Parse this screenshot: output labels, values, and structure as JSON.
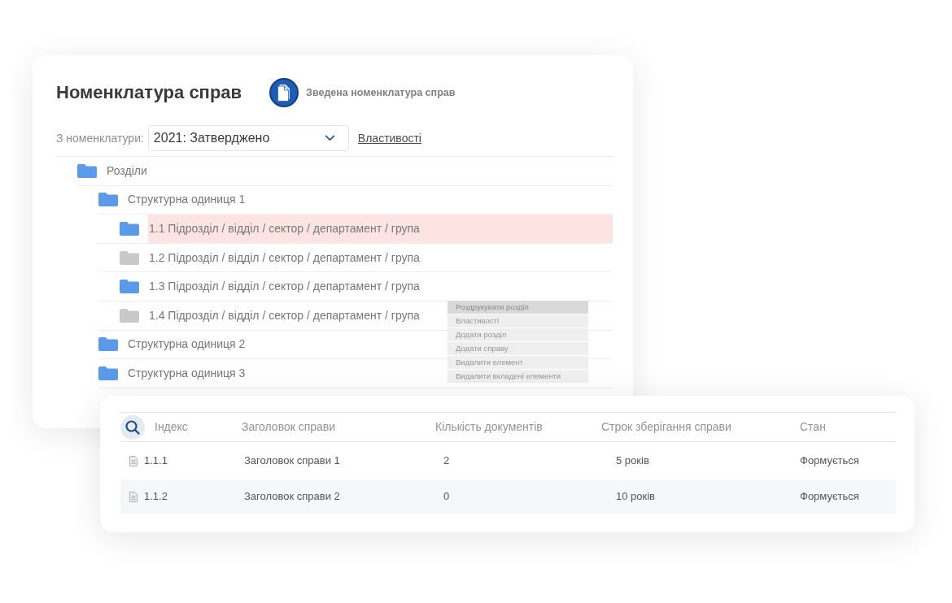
{
  "main_panel": {
    "title": "Номенклатура справ",
    "summary_link": {
      "label": "Зведена номенклатура справ"
    },
    "filter": {
      "label": "З номенклатури:",
      "value": "2021: Затверджено",
      "properties_link": "Властивості"
    },
    "tree": [
      {
        "label": "Розділи",
        "color": "#5b9ae8",
        "selected": false,
        "children": [
          {
            "label": "Структурна одиниця 1",
            "color": "#5b9ae8",
            "selected": false,
            "children": [
              {
                "label": "1.1 Підрозділ / відділ / сектор / департамент / група",
                "color": "#5b9ae8",
                "selected": true
              },
              {
                "label": "1.2 Підрозділ / відділ / сектор / департамент / група",
                "color": "#c9c9c9",
                "selected": false
              },
              {
                "label": "1.3 Підрозділ / відділ / сектор / департамент / група",
                "color": "#5b9ae8",
                "selected": false
              },
              {
                "label": "1.4 Підрозділ / відділ / сектор / департамент / група",
                "color": "#c9c9c9",
                "selected": false
              }
            ]
          },
          {
            "label": "Структурна одиниця 2",
            "color": "#5b9ae8",
            "selected": false
          },
          {
            "label": "Структурна одиниця 3",
            "color": "#5b9ae8",
            "selected": false
          }
        ]
      }
    ]
  },
  "context_menu": {
    "items": [
      {
        "label": "Роздрукувати розділ",
        "selected": true
      },
      {
        "label": "Властивості",
        "selected": false
      },
      {
        "label": "Додати розділ",
        "selected": false
      },
      {
        "label": "Додати справу",
        "selected": false
      },
      {
        "label": "Видалити елемент",
        "selected": false
      },
      {
        "label": "Видалити вкладені елементи",
        "selected": false
      }
    ]
  },
  "cases_table": {
    "columns": [
      "Індекс",
      "Заголовок справи",
      "Кількість документів",
      "Строк зберігання справи",
      "Стан"
    ],
    "rows": [
      {
        "cells": [
          "1.1.1",
          "Заголовок справи 1",
          "2",
          "5 років",
          "Формується"
        ]
      },
      {
        "cells": [
          "1.1.2",
          "Заголовок справи 2",
          "0",
          "10 років",
          "Формується"
        ]
      }
    ]
  }
}
